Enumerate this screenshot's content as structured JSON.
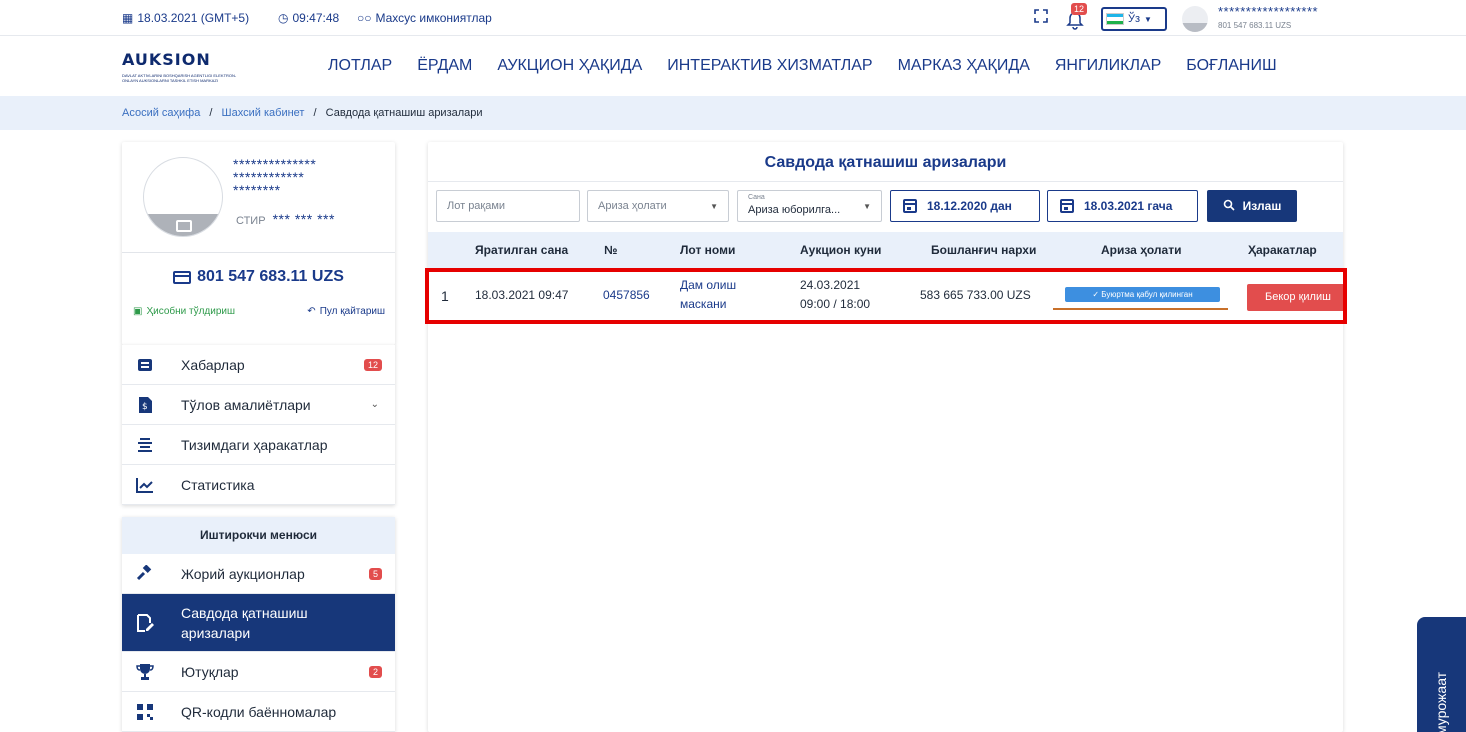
{
  "topbar": {
    "date": "18.03.2021 (GMT+5)",
    "time": "09:47:48",
    "accessibility": "Махсус имкониятлар",
    "notifications_count": "12",
    "language": "Ўз",
    "user_stars": "******************",
    "user_balance": "801 547 683.11 UZS"
  },
  "header": {
    "logo_text": "AUKSION",
    "logo_sub": "DAVLAT AKTIVLARINI BOSHQARISH AGENTLIGI ELEKTRON-ONLAYN AUKSIONLARNI TASHKIL ETISH MARKAZI",
    "nav": [
      "ЛОТЛАР",
      "ЁРДАМ",
      "АУКЦИОН ҲАҚИДА",
      "ИНТЕРАКТИВ ХИЗМАТЛАР",
      "МАРКАЗ ҲАҚИДА",
      "ЯНГИЛИКЛАР",
      "БОҒЛАНИШ"
    ]
  },
  "breadcrumb": {
    "home": "Асосий саҳифа",
    "cabinet": "Шахсий кабинет",
    "current": "Савдода қатнашиш аризалари",
    "sep": "/"
  },
  "profile": {
    "name_line1": "**************",
    "name_line2": "************",
    "name_line3": "********",
    "stir_label": "СТИР",
    "stir_value": "*** *** ***",
    "balance": "801 547 683.11 UZS",
    "topup": "Ҳисобни тўлдириш",
    "refund": "Пул қайтариш"
  },
  "menu": {
    "items": [
      {
        "label": "Хабарлар",
        "badge": "12"
      },
      {
        "label": "Тўлов амалиётлари"
      },
      {
        "label": "Тизимдаги ҳаракатлар"
      },
      {
        "label": "Статистика"
      }
    ]
  },
  "participant_menu": {
    "title": "Иштирокчи менюси",
    "items": [
      {
        "label": "Жорий аукционлар",
        "badge": "5"
      },
      {
        "label": "Савдода қатнашиш аризалари"
      },
      {
        "label": "Ютуқлар",
        "badge": "2"
      },
      {
        "label": "QR-кодли баённомалар"
      }
    ]
  },
  "main": {
    "title": "Савдода қатнашиш аризалари",
    "filters": {
      "lot_placeholder": "Лот рақами",
      "status_placeholder": "Ариза ҳолати",
      "date_small_label": "Сана",
      "date_type_value": "Ариза юборилга...",
      "date_from": "18.12.2020 дан",
      "date_to": "18.03.2021 гача",
      "search": "Излаш"
    },
    "columns": [
      "Яратилган сана",
      "№",
      "Лот номи",
      "Аукцион куни",
      "Бошланғич нархи",
      "Ариза ҳолати",
      "Ҳаракатлар"
    ],
    "rows": [
      {
        "index": "1",
        "created": "18.03.2021 09:47",
        "number": "0457856",
        "lot_name_1": "Дам олиш",
        "lot_name_2": "маскани",
        "auction_date": "24.03.2021",
        "auction_time": "09:00 / 18:00",
        "start_price": "583 665 733.00 UZS",
        "status": "✓ Буюртма қабул қилинган",
        "action": "Бекор қилиш"
      }
    ]
  },
  "side_tab": "мурожаат",
  "colors": {
    "primary": "#17377a",
    "accent_link": "#1a3a8a",
    "danger": "#e24d4d",
    "status": "#3d8fe0",
    "highlight": "#e60000"
  }
}
